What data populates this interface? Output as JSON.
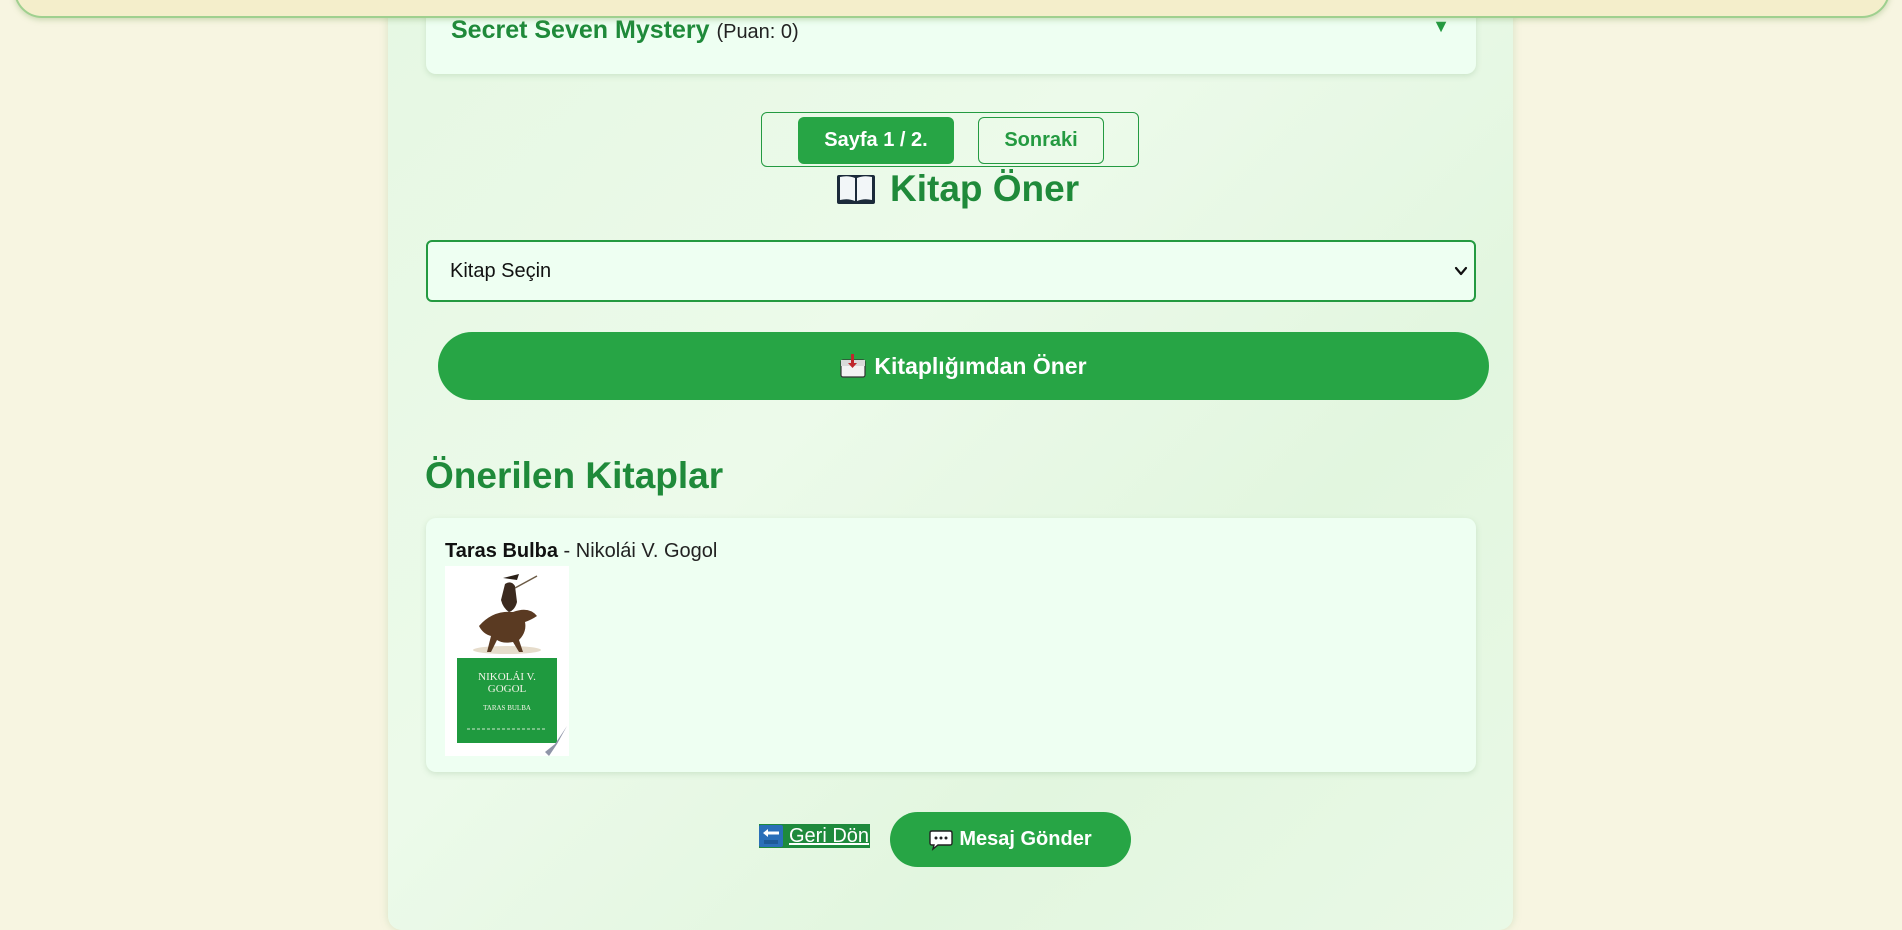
{
  "accordion": {
    "book_title": "Secret Seven Mystery",
    "score_text": "(Puan: 0)",
    "toggle_glyph": "▼"
  },
  "pagination": {
    "page_indicator": "Sayfa 1 / 2.",
    "next_label": "Sonraki"
  },
  "recommend_section": {
    "heading": "Kitap Öner",
    "heading_icon": "open-book-icon",
    "select_value": "Kitap Seçin",
    "button_label": "Kitaplığımdan Öner",
    "button_icon": "inbox-tray-icon"
  },
  "recommended_books": {
    "heading": "Önerilen Kitaplar",
    "items": [
      {
        "title": "Taras Bulba",
        "separator": " - ",
        "author": "Nikolái V. Gogol",
        "cover": {
          "author_line1": "NIKOLÁI V.",
          "author_line2": "GOGOL",
          "title": "TARAS BULBA"
        }
      }
    ]
  },
  "footer": {
    "back_label": "Geri Dön",
    "back_icon": "back-arrow-icon",
    "message_label": "Mesaj Gönder",
    "message_icon": "speech-bubble-icon"
  },
  "colors": {
    "primary_green": "#27a545",
    "heading_green": "#1f8a3a",
    "page_background": "#f7f5e1",
    "panel_background": "#e6f8e3",
    "card_background": "#eefff2"
  }
}
